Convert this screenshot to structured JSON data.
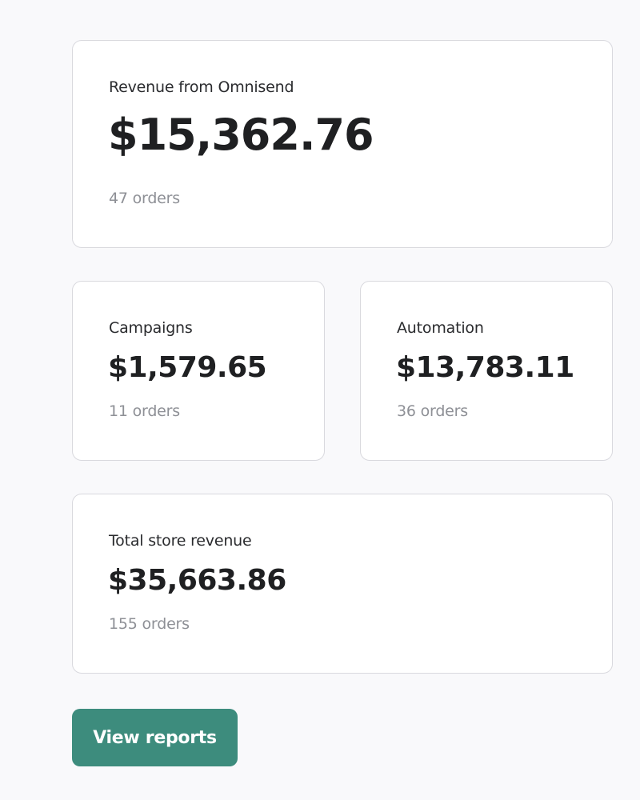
{
  "revenue_summary": {
    "omnisend": {
      "label": "Revenue from Omnisend",
      "value": "$15,362.76",
      "orders": "47 orders"
    },
    "campaigns": {
      "label": "Campaigns",
      "value": "$1,579.65",
      "orders": "11 orders"
    },
    "automation": {
      "label": "Automation",
      "value": "$13,783.11",
      "orders": "36 orders"
    },
    "total_store": {
      "label": "Total store revenue",
      "value": "$35,663.86",
      "orders": "155 orders"
    }
  },
  "actions": {
    "view_reports_label": "View reports"
  },
  "colors": {
    "background": "#f9f9fb",
    "card": "#ffffff",
    "card_border": "#d9d9de",
    "primary_button": "#3d8c7d",
    "secondary_text": "#8e9096"
  }
}
